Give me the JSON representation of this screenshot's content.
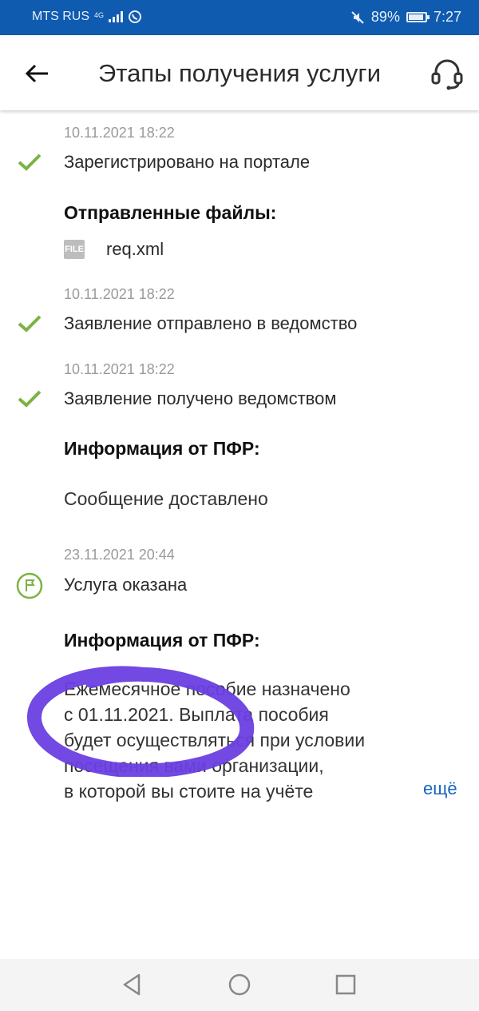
{
  "status_bar": {
    "carrier": "MTS RUS",
    "network": "4G",
    "battery": "89%",
    "battery_level": 0.89,
    "time": "7:27"
  },
  "header": {
    "title": "Этапы получения услуги",
    "back_icon": "arrow-left-icon",
    "support_icon": "headset-icon"
  },
  "timeline": {
    "step1": {
      "date": "10.11.2021 18:22",
      "text": "Зарегистрировано на портале"
    },
    "files": {
      "title": "Отправленные файлы:",
      "file_icon_label": "FILE",
      "file_name": "req.xml"
    },
    "step2": {
      "date": "10.11.2021 18:22",
      "text": "Заявление отправлено в ведомство"
    },
    "step3": {
      "date": "10.11.2021 18:22",
      "text": "Заявление получено ведомством"
    },
    "info1": {
      "title": "Информация от ПФР:",
      "text": "Сообщение доставлено"
    },
    "step4": {
      "date": "23.11.2021 20:44",
      "text": "Услуга оказана"
    },
    "info2": {
      "title": "Информация от ПФР:",
      "lines": [
        "Ежемесячное пособие назначено",
        "с 01.11.2021. Выплата пособия",
        "будет осуществляться при условии",
        "посещения вами организации,",
        "в которой вы стоите на учёте"
      ],
      "more": "ещё"
    }
  },
  "colors": {
    "status_bar": "#0f5bb0",
    "check": "#7cb342",
    "flag": "#7cb342",
    "link": "#1565c0",
    "scribble": "#6a3fe0"
  }
}
